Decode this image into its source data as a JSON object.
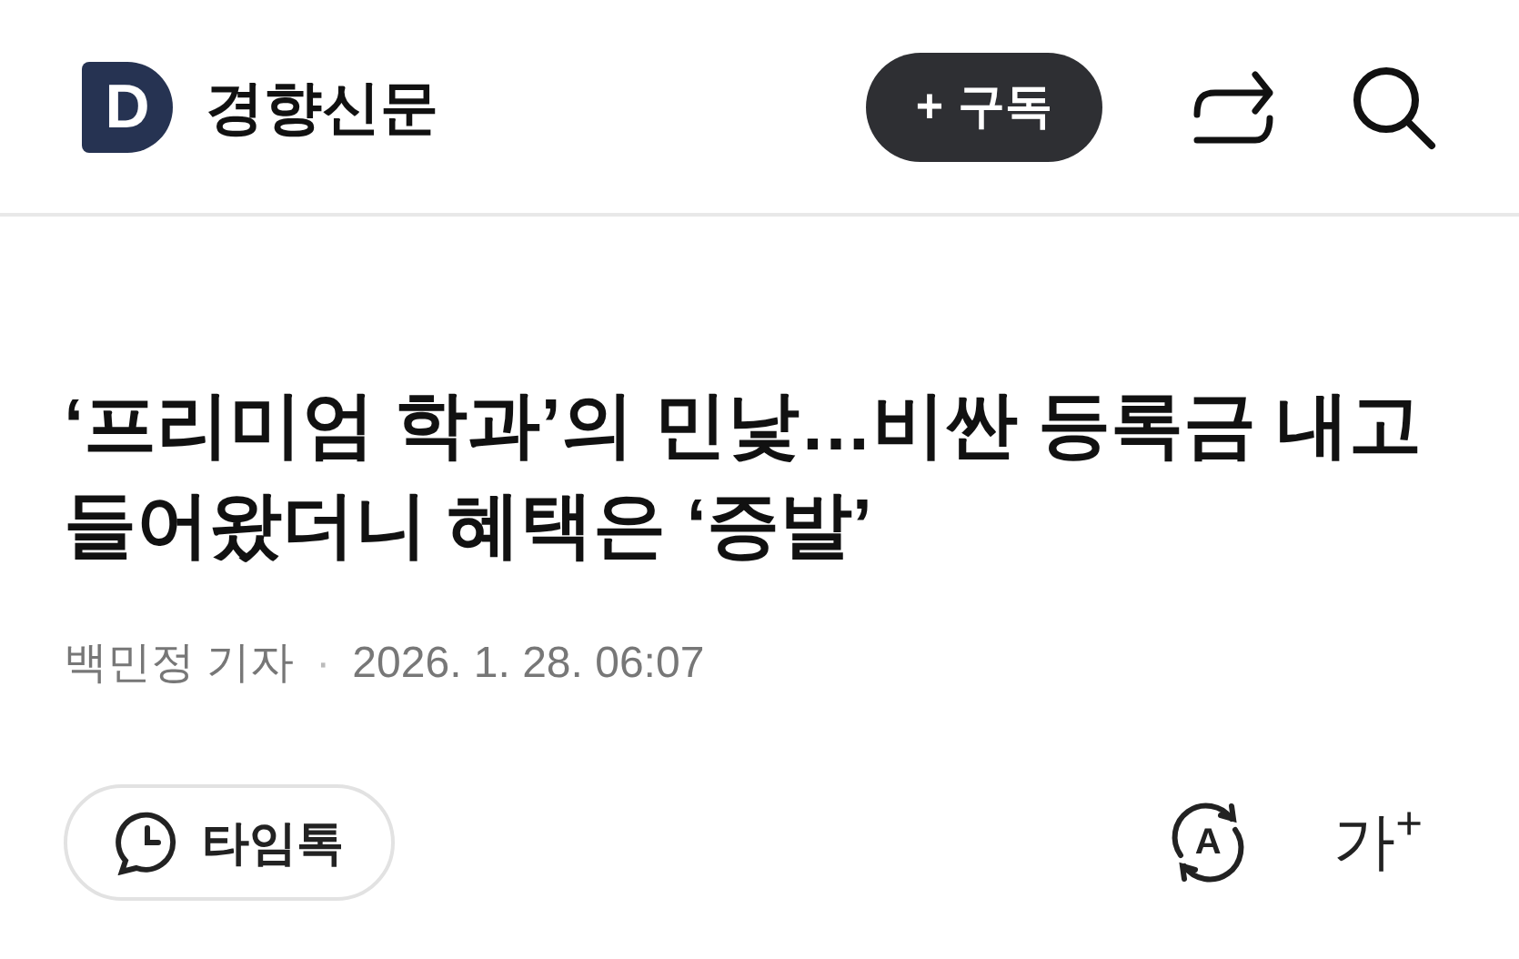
{
  "header": {
    "logo_letter": "D",
    "brand": "경향신문",
    "subscribe_button": {
      "icon": "+",
      "label": "구독"
    }
  },
  "article": {
    "headline": "‘프리미엄 학과’의 민낯…비싼 등록금 내고 들어왔더니 혜택은 ‘증발’",
    "byline": "백민정 기자",
    "separator": "·",
    "date": "2026. 1. 28. 06:07"
  },
  "toolbar": {
    "timetalk_label": "타임톡",
    "translate_letter": "A",
    "font_size_label": "가$^{+}$"
  }
}
